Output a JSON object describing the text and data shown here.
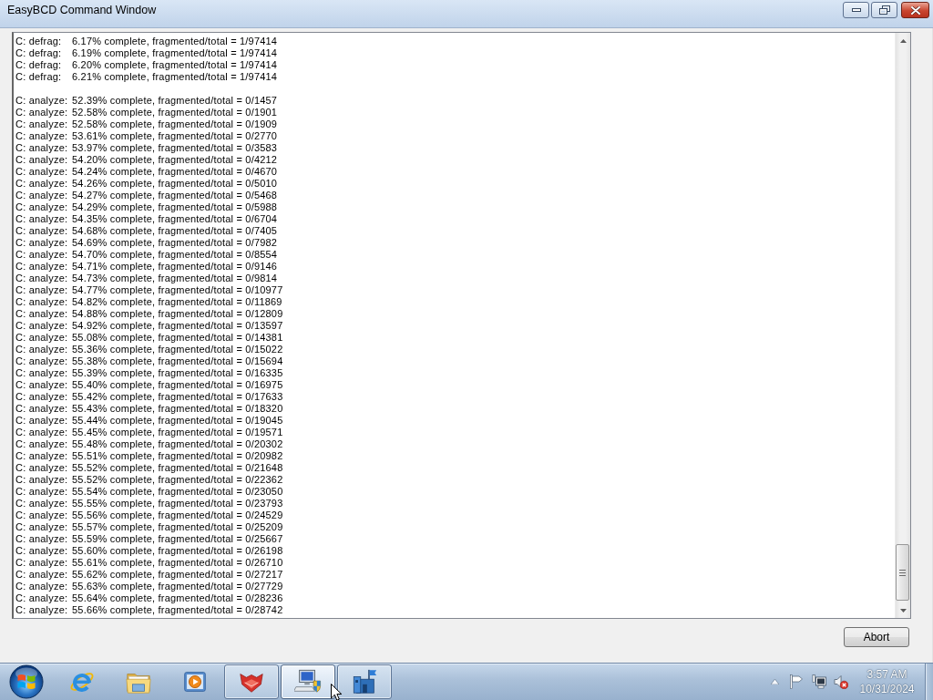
{
  "window": {
    "title": "EasyBCD Command Window",
    "maximized": true
  },
  "log": {
    "blocks": [
      {
        "lines": [
          "C: defrag:\t6.17% complete, fragmented/total = 1/97414",
          "C: defrag:\t6.19% complete, fragmented/total = 1/97414",
          "C: defrag:\t6.20% complete, fragmented/total = 1/97414",
          "C: defrag:\t6.21% complete, fragmented/total = 1/97414"
        ]
      },
      {
        "lines": [
          "C: analyze:\t52.39% complete, fragmented/total = 0/1457",
          "C: analyze:\t52.58% complete, fragmented/total = 0/1901",
          "C: analyze:\t52.58% complete, fragmented/total = 0/1909",
          "C: analyze:\t53.61% complete, fragmented/total = 0/2770",
          "C: analyze:\t53.97% complete, fragmented/total = 0/3583",
          "C: analyze:\t54.20% complete, fragmented/total = 0/4212",
          "C: analyze:\t54.24% complete, fragmented/total = 0/4670",
          "C: analyze:\t54.26% complete, fragmented/total = 0/5010",
          "C: analyze:\t54.27% complete, fragmented/total = 0/5468",
          "C: analyze:\t54.29% complete, fragmented/total = 0/5988",
          "C: analyze:\t54.35% complete, fragmented/total = 0/6704",
          "C: analyze:\t54.68% complete, fragmented/total = 0/7405",
          "C: analyze:\t54.69% complete, fragmented/total = 0/7982",
          "C: analyze:\t54.70% complete, fragmented/total = 0/8554",
          "C: analyze:\t54.71% complete, fragmented/total = 0/9146",
          "C: analyze:\t54.73% complete, fragmented/total = 0/9814",
          "C: analyze:\t54.77% complete, fragmented/total = 0/10977",
          "C: analyze:\t54.82% complete, fragmented/total = 0/11869",
          "C: analyze:\t54.88% complete, fragmented/total = 0/12809",
          "C: analyze:\t54.92% complete, fragmented/total = 0/13597",
          "C: analyze:\t55.08% complete, fragmented/total = 0/14381",
          "C: analyze:\t55.36% complete, fragmented/total = 0/15022",
          "C: analyze:\t55.38% complete, fragmented/total = 0/15694",
          "C: analyze:\t55.39% complete, fragmented/total = 0/16335",
          "C: analyze:\t55.40% complete, fragmented/total = 0/16975",
          "C: analyze:\t55.42% complete, fragmented/total = 0/17633",
          "C: analyze:\t55.43% complete, fragmented/total = 0/18320",
          "C: analyze:\t55.44% complete, fragmented/total = 0/19045",
          "C: analyze:\t55.45% complete, fragmented/total = 0/19571",
          "C: analyze:\t55.48% complete, fragmented/total = 0/20302",
          "C: analyze:\t55.51% complete, fragmented/total = 0/20982",
          "C: analyze:\t55.52% complete, fragmented/total = 0/21648",
          "C: analyze:\t55.52% complete, fragmented/total = 0/22362",
          "C: analyze:\t55.54% complete, fragmented/total = 0/23050",
          "C: analyze:\t55.55% complete, fragmented/total = 0/23793",
          "C: analyze:\t55.56% complete, fragmented/total = 0/24529",
          "C: analyze:\t55.57% complete, fragmented/total = 0/25209",
          "C: analyze:\t55.59% complete, fragmented/total = 0/25667",
          "C: analyze:\t55.60% complete, fragmented/total = 0/26198",
          "C: analyze:\t55.61% complete, fragmented/total = 0/26710",
          "C: analyze:\t55.62% complete, fragmented/total = 0/27217",
          "C: analyze:\t55.63% complete, fragmented/total = 0/27729",
          "C: analyze:\t55.64% complete, fragmented/total = 0/28236",
          "C: analyze:\t55.66% complete, fragmented/total = 0/28742"
        ]
      }
    ]
  },
  "buttons": [
    "Abort"
  ],
  "taskbar": {
    "apps": [
      {
        "running": false,
        "selected": false
      },
      {
        "running": false,
        "selected": false
      },
      {
        "running": false,
        "selected": false
      },
      {
        "running": true,
        "selected": false
      },
      {
        "running": true,
        "selected": true
      },
      {
        "running": true,
        "selected": false
      }
    ],
    "tray": {
      "volume_muted": true
    },
    "clock": {
      "time": "3:57 AM",
      "date": "10/31/2024"
    }
  }
}
